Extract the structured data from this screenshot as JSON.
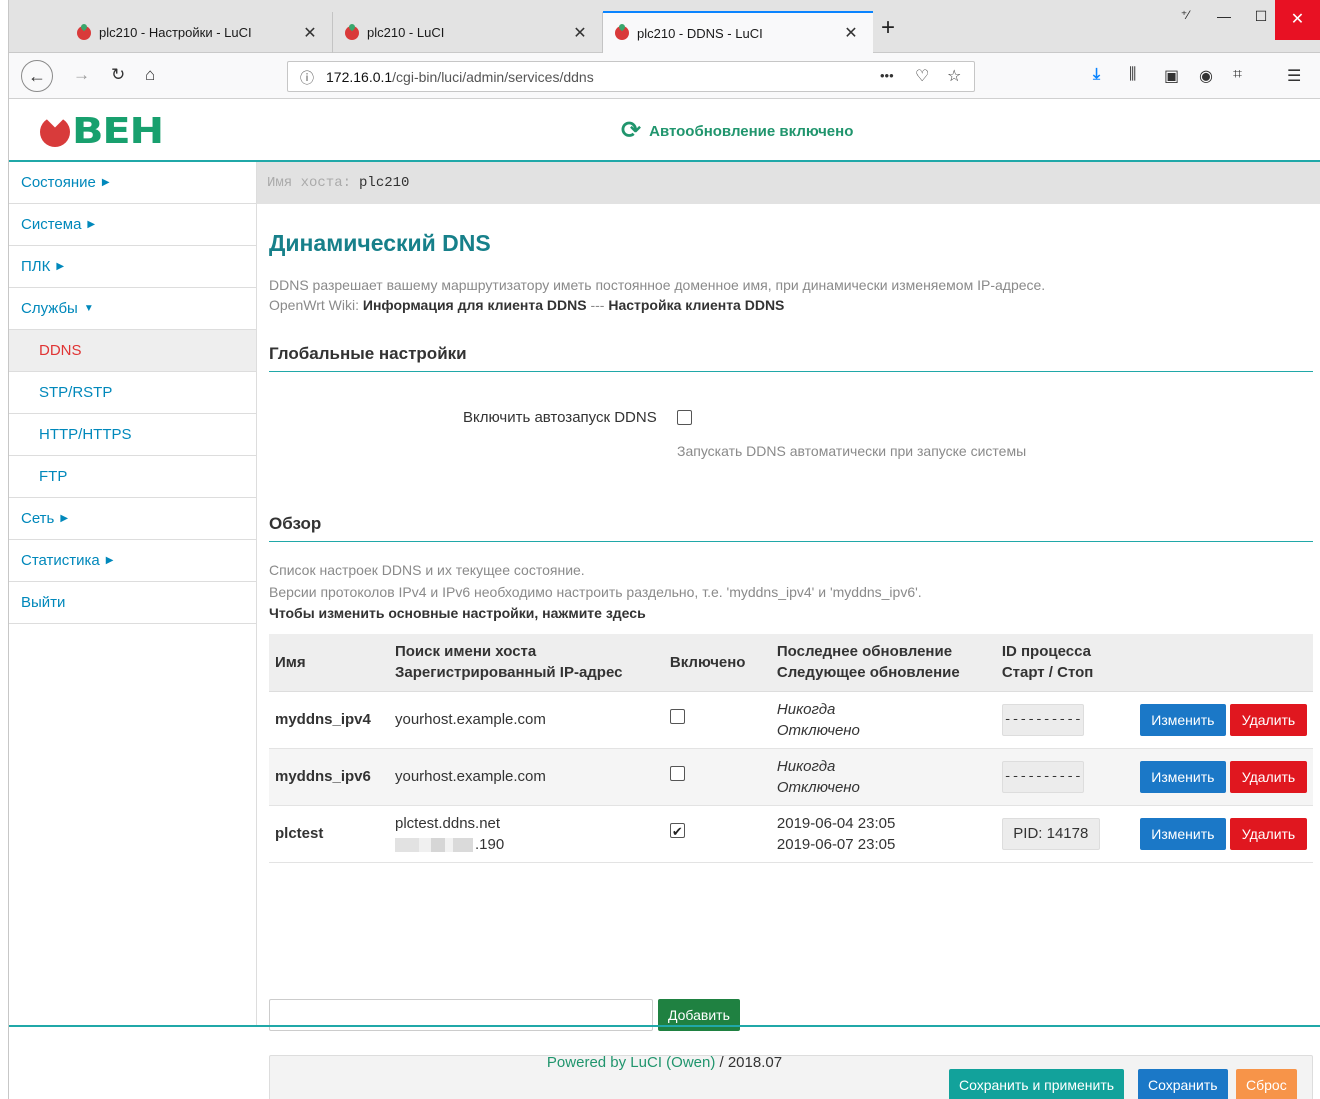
{
  "browser": {
    "tabs": [
      {
        "title": "plc210 - Настройки - LuCI",
        "close": "✕"
      },
      {
        "title": "plc210 - LuCI",
        "close": "✕"
      },
      {
        "title": "plc210 - DDNS - LuCI",
        "close": "✕"
      }
    ],
    "new_tab": "+",
    "url_host": "172.16.0.1",
    "url_path": "/cgi-bin/luci/admin/services/ddns",
    "url_menu": "•••"
  },
  "header": {
    "logo_text": "ВЕН",
    "autoupdate": "Автообновление включено"
  },
  "sidebar": {
    "items": [
      {
        "label": "Состояние",
        "caret": "▶"
      },
      {
        "label": "Система",
        "caret": "▶"
      },
      {
        "label": "ПЛК",
        "caret": "▶"
      },
      {
        "label": "Службы",
        "caret": "▼"
      },
      {
        "label": "DDNS"
      },
      {
        "label": "STP/RSTP"
      },
      {
        "label": "HTTP/HTTPS"
      },
      {
        "label": "FTP"
      },
      {
        "label": "Сеть",
        "caret": "▶"
      },
      {
        "label": "Статистика",
        "caret": "▶"
      },
      {
        "label": "Выйти"
      }
    ]
  },
  "hostbar": {
    "label": "Имя хоста:",
    "value": "plc210"
  },
  "main": {
    "title": "Динамический DNS",
    "desc": "DDNS разрешает вашему маршрутизатору иметь постоянное доменное имя, при динамически изменяемом IP-адресе.",
    "wiki_prefix": "OpenWrt Wiki: ",
    "wiki_link1": "Информация для клиента DDNS",
    "wiki_sep": " --- ",
    "wiki_link2": "Настройка клиента DDNS",
    "global_title": "Глобальные настройки",
    "autostart_label": "Включить автозапуск DDNS",
    "autostart_hint": "Запускать DDNS автоматически при запуске системы",
    "overview_title": "Обзор",
    "overview_desc1": "Список настроек DDNS и их текущее состояние.",
    "overview_desc2": "Версии протоколов IPv4 и IPv6 необходимо настроить раздельно, т.е. 'myddns_ipv4' и 'myddns_ipv6'.",
    "overview_link": "Чтобы изменить основные настройки, нажмите здесь"
  },
  "table": {
    "headers": {
      "name": "Имя",
      "host1": "Поиск имени хоста",
      "host2": "Зарегистрированный IP-адрес",
      "enabled": "Включено",
      "upd1": "Последнее обновление",
      "upd2": "Следующее обновление",
      "pid1": "ID процесса",
      "pid2": "Старт / Стоп"
    },
    "rows": [
      {
        "name": "myddns_ipv4",
        "host": "yourhost.example.com",
        "ip": "",
        "last": "Никогда",
        "next": "Отключено",
        "pid": "----------",
        "edit": "Изменить",
        "delete": "Удалить"
      },
      {
        "name": "myddns_ipv6",
        "host": "yourhost.example.com",
        "ip": "",
        "last": "Никогда",
        "next": "Отключено",
        "pid": "----------",
        "edit": "Изменить",
        "delete": "Удалить"
      },
      {
        "name": "plctest",
        "host": "plctest.ddns.net",
        "ip": ".190",
        "last": "2019-06-04 23:05",
        "next": "2019-06-07 23:05",
        "pid": "PID: 14178",
        "edit": "Изменить",
        "delete": "Удалить"
      }
    ]
  },
  "actions": {
    "add": "Добавить",
    "save_apply": "Сохранить и применить",
    "save": "Сохранить",
    "reset": "Сброс"
  },
  "footer": {
    "powered": "Powered by LuCI (Owen)",
    "version": " / 2018.07"
  }
}
